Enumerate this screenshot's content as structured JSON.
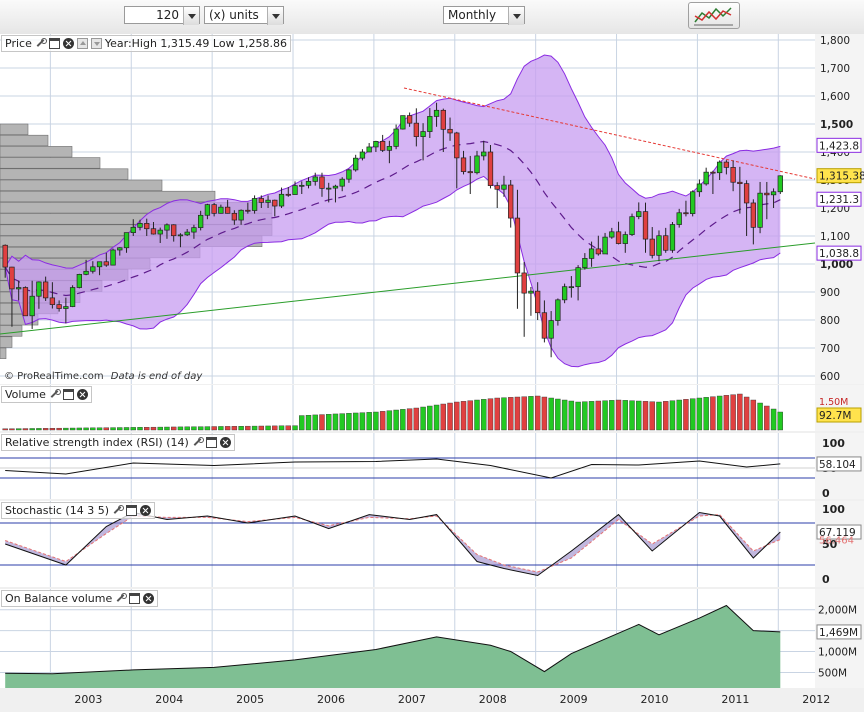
{
  "toolbar": {
    "units_value": "120",
    "units_label": "(x) units",
    "period_value": "Monthly"
  },
  "price_panel": {
    "title": "Price",
    "stats": "Year:High 1,315.49 Low 1,258.86",
    "watermark_brand": "© ProRealTime.com",
    "watermark_note": "Data is end of day",
    "badges": {
      "last": "1,315.38",
      "bb_upper": "1,423.8",
      "bb_mid": "1,231.3",
      "bb_lower": "1,038.8"
    },
    "y_ticks": [
      "1,800",
      "1,700",
      "1,600",
      "1,500",
      "1,400",
      "1,300",
      "1,200",
      "1,100",
      "1,000",
      "900",
      "800",
      "700",
      "600"
    ]
  },
  "volume_panel": {
    "title": "Volume",
    "badges": {
      "avg": "1.50M",
      "last": "92.7M"
    }
  },
  "rsi_panel": {
    "title": "Relative strength index (RSI) (14)",
    "badge": "58.104",
    "y_ticks": [
      "100",
      "50",
      "0"
    ]
  },
  "stoch_panel": {
    "title": "Stochastic (14 3 5)",
    "badges": {
      "k": "67.119",
      "d": "56.464"
    },
    "y_ticks": [
      "100",
      "50",
      "0"
    ]
  },
  "obv_panel": {
    "title": "On Balance volume",
    "badge": "1,469M",
    "y_ticks": [
      "2,000M",
      "1,500M",
      "1,000M",
      "500M"
    ]
  },
  "x_axis": {
    "ticks": [
      "2003",
      "2004",
      "2005",
      "2006",
      "2007",
      "2008",
      "2009",
      "2010",
      "2011",
      "2012"
    ]
  },
  "colors": {
    "up": "#22c922",
    "down": "#e04040",
    "band": "#c79cf0",
    "band_line": "#8a2be2",
    "ma": "#6a1b9a",
    "trend_up": "#2a9d2a",
    "trend_down": "#e53935",
    "obv": "#7fbf93"
  },
  "chart_data": [
    {
      "type": "candlestick",
      "name": "Price",
      "x": [
        "2002-06",
        "2002-07",
        "2002-08",
        "2002-09",
        "2002-10",
        "2002-11",
        "2002-12",
        "2003-01",
        "2003-02",
        "2003-03",
        "2003-04",
        "2003-05",
        "2003-06",
        "2003-07",
        "2003-08",
        "2003-09",
        "2003-10",
        "2003-11",
        "2003-12",
        "2004-01",
        "2004-02",
        "2004-03",
        "2004-04",
        "2004-05",
        "2004-06",
        "2004-07",
        "2004-08",
        "2004-09",
        "2004-10",
        "2004-11",
        "2004-12",
        "2005-01",
        "2005-02",
        "2005-03",
        "2005-04",
        "2005-05",
        "2005-06",
        "2005-07",
        "2005-08",
        "2005-09",
        "2005-10",
        "2005-11",
        "2005-12",
        "2006-01",
        "2006-02",
        "2006-03",
        "2006-04",
        "2006-05",
        "2006-06",
        "2006-07",
        "2006-08",
        "2006-09",
        "2006-10",
        "2006-11",
        "2006-12",
        "2007-01",
        "2007-02",
        "2007-03",
        "2007-04",
        "2007-05",
        "2007-06",
        "2007-07",
        "2007-08",
        "2007-09",
        "2007-10",
        "2007-11",
        "2007-12",
        "2008-01",
        "2008-02",
        "2008-03",
        "2008-04",
        "2008-05",
        "2008-06",
        "2008-07",
        "2008-08",
        "2008-09",
        "2008-10",
        "2008-11",
        "2008-12",
        "2009-01",
        "2009-02",
        "2009-03",
        "2009-04",
        "2009-05",
        "2009-06",
        "2009-07",
        "2009-08",
        "2009-09",
        "2009-10",
        "2009-11",
        "2009-12",
        "2010-01",
        "2010-02",
        "2010-03",
        "2010-04",
        "2010-05",
        "2010-06",
        "2010-07",
        "2010-08",
        "2010-09",
        "2010-10",
        "2010-11",
        "2010-12",
        "2011-01",
        "2011-02",
        "2011-03",
        "2011-04",
        "2011-05",
        "2011-06",
        "2011-07",
        "2011-08",
        "2011-09",
        "2011-10",
        "2011-11",
        "2011-12",
        "2012-01"
      ],
      "open": [
        1067,
        989,
        911,
        916,
        815,
        885,
        936,
        879,
        855,
        841,
        848,
        916,
        963,
        974,
        990,
        1008,
        996,
        1050,
        1058,
        1112,
        1131,
        1145,
        1126,
        1107,
        1121,
        1140,
        1101,
        1104,
        1114,
        1130,
        1174,
        1212,
        1181,
        1203,
        1181,
        1157,
        1192,
        1191,
        1234,
        1220,
        1228,
        1207,
        1249,
        1248,
        1280,
        1281,
        1295,
        1311,
        1270,
        1271,
        1278,
        1303,
        1336,
        1378,
        1400,
        1418,
        1438,
        1406,
        1420,
        1482,
        1530,
        1503,
        1455,
        1473,
        1527,
        1549,
        1481,
        1468,
        1379,
        1330,
        1326,
        1386,
        1400,
        1280,
        1267,
        1282,
        1164,
        968,
        896,
        903,
        826,
        735,
        798,
        872,
        919,
        919,
        987,
        1020,
        1054,
        1036,
        1096,
        1115,
        1073,
        1105,
        1169,
        1187,
        1089,
        1031,
        1101,
        1049,
        1141,
        1183,
        1180,
        1258,
        1286,
        1328,
        1326,
        1364,
        1345,
        1292,
        1287,
        1218,
        1131,
        1253,
        1247,
        1258
      ],
      "high": [
        1070,
        990,
        940,
        920,
        940,
        938,
        955,
        935,
        870,
        880,
        924,
        965,
        1015,
        1010,
        1000,
        1040,
        1055,
        1060,
        1112,
        1160,
        1158,
        1162,
        1150,
        1130,
        1145,
        1142,
        1110,
        1125,
        1140,
        1190,
        1215,
        1218,
        1212,
        1229,
        1192,
        1195,
        1219,
        1245,
        1245,
        1245,
        1230,
        1273,
        1275,
        1295,
        1295,
        1310,
        1326,
        1326,
        1290,
        1283,
        1310,
        1340,
        1390,
        1410,
        1432,
        1440,
        1461,
        1440,
        1498,
        1530,
        1541,
        1556,
        1503,
        1557,
        1576,
        1555,
        1523,
        1472,
        1404,
        1386,
        1404,
        1440,
        1425,
        1292,
        1315,
        1300,
        1265,
        1007,
        918,
        935,
        870,
        832,
        877,
        930,
        957,
        996,
        1039,
        1080,
        1101,
        1111,
        1129,
        1151,
        1116,
        1180,
        1220,
        1219,
        1132,
        1120,
        1129,
        1150,
        1197,
        1226,
        1263,
        1302,
        1344,
        1333,
        1370,
        1371,
        1370,
        1347,
        1299,
        1231,
        1293,
        1293,
        1270,
        1317
      ],
      "low": [
        951,
        776,
        870,
        815,
        768,
        840,
        868,
        841,
        830,
        788,
        846,
        913,
        960,
        966,
        960,
        990,
        995,
        1030,
        1040,
        1100,
        1120,
        1100,
        1105,
        1075,
        1090,
        1080,
        1060,
        1100,
        1090,
        1120,
        1160,
        1170,
        1180,
        1180,
        1140,
        1140,
        1180,
        1180,
        1200,
        1200,
        1170,
        1200,
        1240,
        1250,
        1250,
        1270,
        1280,
        1240,
        1220,
        1220,
        1260,
        1290,
        1330,
        1370,
        1400,
        1400,
        1400,
        1360,
        1410,
        1480,
        1490,
        1420,
        1370,
        1450,
        1490,
        1400,
        1440,
        1270,
        1320,
        1250,
        1320,
        1370,
        1270,
        1200,
        1240,
        1130,
        840,
        740,
        815,
        800,
        720,
        667,
        780,
        860,
        880,
        870,
        980,
        990,
        1030,
        1040,
        1090,
        1070,
        1040,
        1100,
        1160,
        1040,
        1020,
        1010,
        1040,
        1040,
        1130,
        1170,
        1170,
        1240,
        1280,
        1250,
        1300,
        1320,
        1260,
        1180,
        1100,
        1070,
        1110,
        1160,
        1200,
        1250
      ],
      "close": [
        989,
        911,
        916,
        815,
        885,
        936,
        879,
        855,
        841,
        848,
        916,
        963,
        974,
        990,
        1008,
        996,
        1050,
        1058,
        1112,
        1131,
        1145,
        1126,
        1107,
        1121,
        1140,
        1101,
        1104,
        1114,
        1130,
        1174,
        1212,
        1181,
        1203,
        1181,
        1157,
        1192,
        1191,
        1234,
        1220,
        1228,
        1207,
        1249,
        1248,
        1280,
        1281,
        1295,
        1311,
        1270,
        1271,
        1278,
        1303,
        1336,
        1378,
        1400,
        1418,
        1438,
        1406,
        1420,
        1482,
        1530,
        1503,
        1455,
        1473,
        1527,
        1549,
        1481,
        1468,
        1379,
        1330,
        1326,
        1386,
        1400,
        1280,
        1267,
        1282,
        1164,
        968,
        896,
        903,
        826,
        735,
        798,
        872,
        919,
        919,
        987,
        1020,
        1054,
        1036,
        1096,
        1115,
        1073,
        1105,
        1169,
        1187,
        1089,
        1031,
        1101,
        1049,
        1141,
        1183,
        1180,
        1258,
        1286,
        1328,
        1326,
        1364,
        1345,
        1292,
        1287,
        1218,
        1131,
        1253,
        1247,
        1258,
        1315
      ],
      "y_range": [
        600,
        1800
      ]
    },
    {
      "type": "bar",
      "name": "Volume",
      "x": [
        "2007-01",
        "2007-07",
        "2008-01",
        "2008-07",
        "2009-01",
        "2009-07",
        "2010-01",
        "2010-07",
        "2011-01",
        "2011-07",
        "2012-01"
      ],
      "values": [
        0.45,
        0.55,
        0.7,
        0.8,
        0.85,
        0.7,
        0.75,
        0.7,
        0.8,
        0.9,
        0.45
      ]
    },
    {
      "type": "line",
      "name": "RSI",
      "x": [
        "2002-06",
        "2003-03",
        "2004-01",
        "2005-01",
        "2006-01",
        "2007-01",
        "2007-10",
        "2008-06",
        "2009-03",
        "2009-09",
        "2010-04",
        "2011-01",
        "2011-08",
        "2012-01"
      ],
      "y": [
        45,
        38,
        60,
        55,
        62,
        63,
        68,
        55,
        30,
        57,
        56,
        64,
        52,
        58.104
      ],
      "y_range": [
        0,
        100
      ]
    },
    {
      "type": "line",
      "name": "Stochastic",
      "x": [
        "2002-06",
        "2002-12",
        "2003-03",
        "2003-09",
        "2004-01",
        "2004-06",
        "2004-12",
        "2005-06",
        "2006-01",
        "2006-06",
        "2006-12",
        "2007-06",
        "2007-10",
        "2008-04",
        "2008-08",
        "2009-01",
        "2009-06",
        "2010-01",
        "2010-06",
        "2011-01",
        "2011-04",
        "2011-09",
        "2012-01"
      ],
      "k": [
        50,
        30,
        20,
        75,
        95,
        85,
        90,
        80,
        90,
        72,
        92,
        85,
        92,
        25,
        15,
        5,
        40,
        92,
        40,
        95,
        90,
        30,
        67.119
      ],
      "d": [
        55,
        35,
        25,
        65,
        90,
        88,
        88,
        82,
        88,
        76,
        88,
        86,
        90,
        35,
        20,
        10,
        30,
        85,
        50,
        90,
        92,
        40,
        56.464
      ],
      "y_range": [
        0,
        100
      ]
    },
    {
      "type": "area",
      "name": "On Balance volume",
      "x": [
        "2002-06",
        "2003-01",
        "2004-01",
        "2005-01",
        "2006-01",
        "2007-01",
        "2007-10",
        "2008-06",
        "2008-09",
        "2009-02",
        "2009-06",
        "2010-04",
        "2010-07",
        "2011-01",
        "2011-05",
        "2011-09",
        "2012-01"
      ],
      "y": [
        480,
        470,
        560,
        620,
        800,
        1050,
        1350,
        1150,
        1000,
        520,
        950,
        1650,
        1400,
        1800,
        2100,
        1500,
        1469
      ],
      "y_range": [
        200,
        2200
      ]
    }
  ]
}
